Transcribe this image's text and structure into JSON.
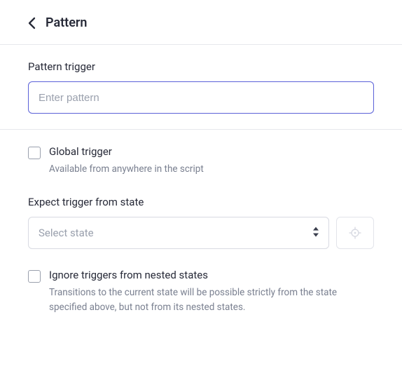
{
  "header": {
    "title": "Pattern"
  },
  "pattern_trigger": {
    "label": "Pattern trigger",
    "placeholder": "Enter pattern",
    "value": ""
  },
  "global_trigger": {
    "label": "Global trigger",
    "desc": "Available from anywhere in the script",
    "checked": false
  },
  "expect_state": {
    "label": "Expect trigger from state",
    "placeholder": "Select state",
    "value": ""
  },
  "ignore_nested": {
    "label": "Ignore triggers from nested states",
    "desc": "Transitions to the current state will be possible strictly from the state specified above, but not from its nested states.",
    "checked": false
  }
}
